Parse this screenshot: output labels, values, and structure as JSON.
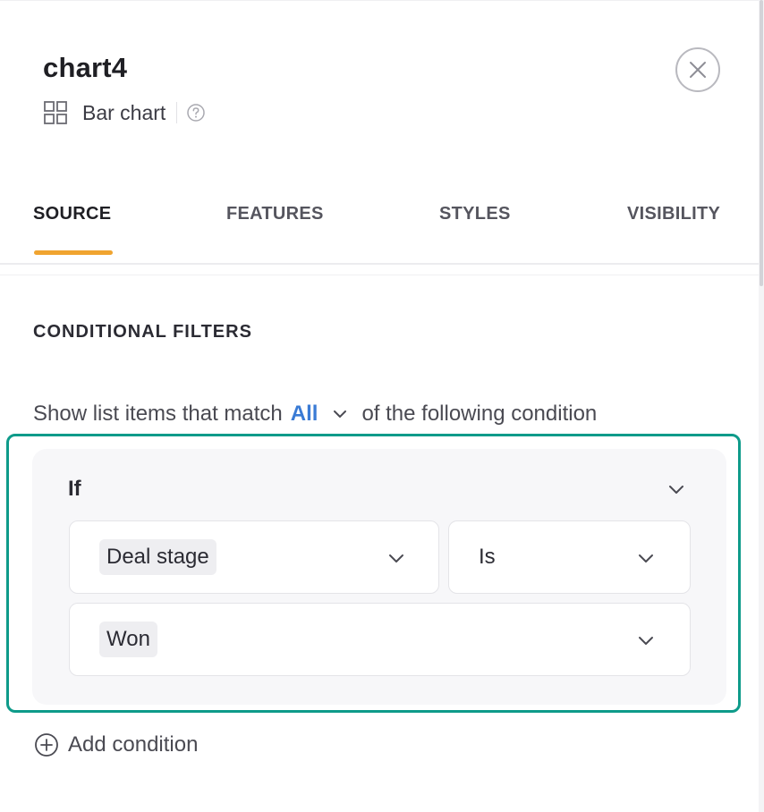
{
  "header": {
    "title": "chart4",
    "chart_type_label": "Bar chart",
    "icons": {
      "chart_type": "grid-icon",
      "help": "help-circle-icon",
      "close": "close-icon"
    }
  },
  "tabs": [
    {
      "label": "SOURCE",
      "active": true
    },
    {
      "label": "FEATURES",
      "active": false
    },
    {
      "label": "STYLES",
      "active": false
    },
    {
      "label": "VISIBILITY",
      "active": false
    }
  ],
  "conditional_filters": {
    "section_title": "CONDITIONAL FILTERS",
    "match_prefix": "Show list items that match",
    "match_value": "All",
    "match_suffix": "of the following condition",
    "condition": {
      "label": "If",
      "field": "Deal stage",
      "operator": "Is",
      "value": "Won"
    },
    "add_condition_label": "Add condition"
  },
  "colors": {
    "accent_tab_underline": "#f0a430",
    "link_blue": "#3a7bd5",
    "highlight_teal": "#0e9b8a",
    "card_background": "#f7f7f9"
  }
}
